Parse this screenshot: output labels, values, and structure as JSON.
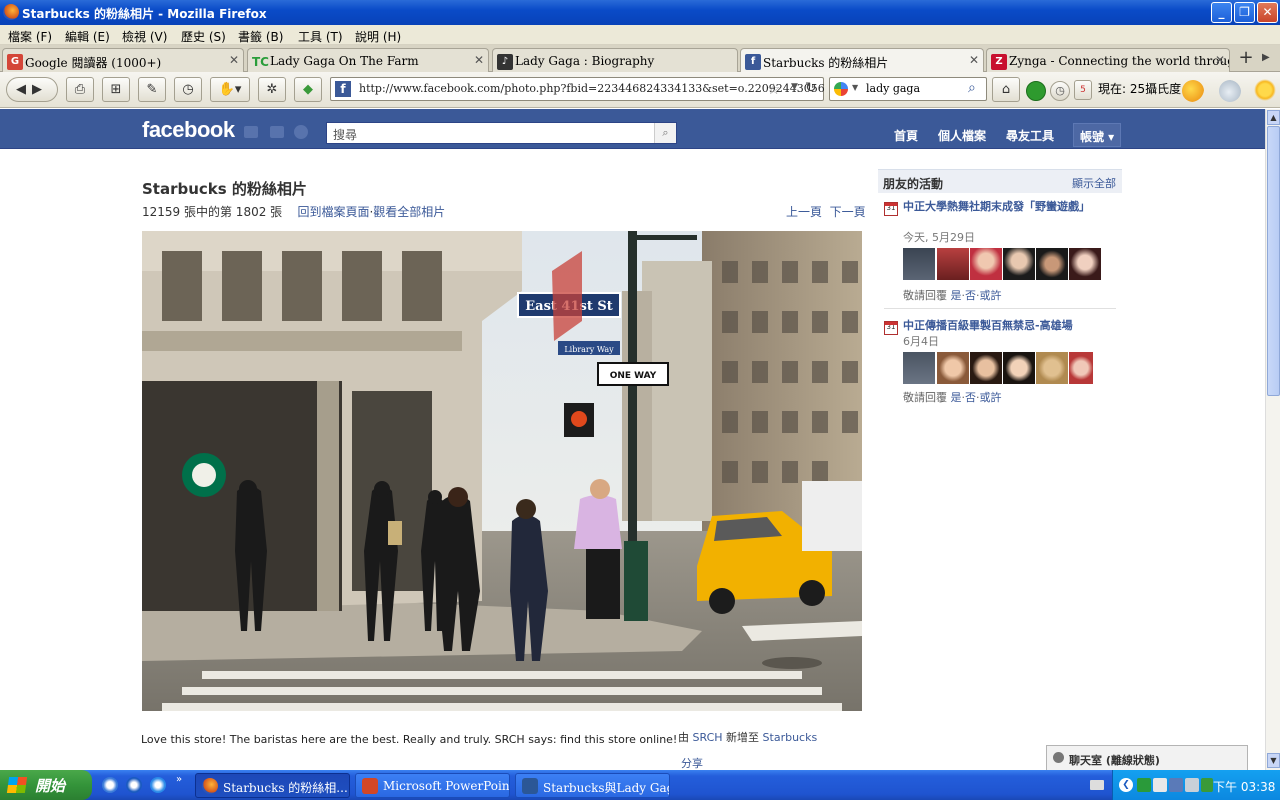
{
  "window": {
    "title": "Starbucks 的粉絲相片 - Mozilla Firefox"
  },
  "menu": [
    "檔案 (F)",
    "編輯 (E)",
    "檢視 (V)",
    "歷史 (S)",
    "書籤 (B)",
    "工具 (T)",
    "說明 (H)"
  ],
  "tabs": [
    {
      "label": "Google 閱讀器 (1000+)",
      "icon": "google-reader-icon",
      "color": "#d44638"
    },
    {
      "label": "Lady Gaga On The Farm",
      "icon": "tc-icon",
      "color": "#2a9d3a"
    },
    {
      "label": "Lady Gaga : Biography",
      "icon": "page-icon",
      "color": "#222222"
    },
    {
      "label": "Starbucks 的粉絲相片",
      "icon": "facebook-icon",
      "color": "#3b5998",
      "active": true
    },
    {
      "label": "Zynga - Connecting the world through g…",
      "icon": "zynga-icon",
      "color": "#c8102e"
    }
  ],
  "nav": {
    "url": "http://www.facebook.com/photo.php?fbid=223446824334133&set=o.22092443056",
    "search_query": "lady gaga",
    "weather": "現在: 25攝氏度"
  },
  "facebook": {
    "logo": "facebook",
    "search_placeholder": "搜尋",
    "nav": [
      "首頁",
      "個人檔案",
      "尋友工具",
      "帳號 ▾"
    ],
    "accent": "#3b5998"
  },
  "photo": {
    "title": "Starbucks 的粉絲相片",
    "count": "12159 張中的第 1802 張",
    "back_link": "回到檔案頁面",
    "all_link": "觀看全部相片",
    "prev": "上一頁",
    "next": "下一頁",
    "caption": "Love this store! The baristas here are the best. Really and truly. SRCH says: find this store online!",
    "added_by_prefix": "由",
    "added_by_user": "SRCH",
    "added_by_mid": "新增至",
    "added_by_page": "Starbucks",
    "share": "分享",
    "sign_street": "East 41st St",
    "sign_library": "Library Way",
    "sign_oneway": "ONE WAY"
  },
  "sidebar": {
    "title": "朋友的活動",
    "show_all": "顯示全部",
    "events": [
      {
        "title": "中正大學熱舞社期末成發「野蠻遊戲」",
        "date": "今天, 5月29日",
        "rsvp_prefix": "敬請回覆",
        "yes": "是",
        "no": "否",
        "maybe": "或許",
        "cal": "31"
      },
      {
        "title": "中正傳播百級畢製百無禁忌-高雄場",
        "date": "6月4日",
        "rsvp_prefix": "敬請回覆",
        "yes": "是",
        "no": "否",
        "maybe": "或許",
        "cal": "31"
      }
    ]
  },
  "chat": {
    "label": "聊天室 (離線狀態)"
  },
  "taskbar": {
    "start": "開始",
    "tasks": [
      {
        "label": "Starbucks 的粉絲相...",
        "active": true
      },
      {
        "label": "Microsoft PowerPoint ...",
        "active": false
      },
      {
        "label": "Starbucks與Lady Gag...",
        "active": false
      }
    ],
    "clock": "下午 03:38"
  }
}
